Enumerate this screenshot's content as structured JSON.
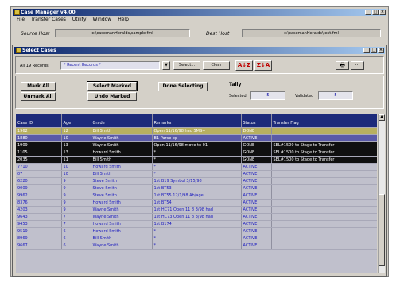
{
  "main_window": {
    "title": "Case Manager v4.00",
    "menu": [
      "File",
      "Transfer Cases",
      "Utility",
      "Window",
      "Help"
    ],
    "source_host_label": "Source Host",
    "source_host_value": "c:\\casemanHeralds\\sample.fml",
    "dest_host_label": "Dest Host",
    "dest_host_value": "c:\\casemanHeralds\\test.fml",
    "buttons": [
      "_",
      "□",
      "×"
    ]
  },
  "select_window": {
    "title": "Select Cases",
    "records_label": "All 19 Records",
    "records_value": "* Recent Records *",
    "select_button": "Select...",
    "clear_button": "Clear",
    "az_button": "A↓Z",
    "za_button": "Z↓A",
    "mark_all": "Mark All",
    "unmark_all": "Unmark All",
    "select_marked": "Select Marked",
    "undo_marked": "Undo Marked",
    "done_selecting": "Done Selecting",
    "tally_label": "Tally",
    "selected_label": "Selected",
    "selected_count": "5",
    "validated_label": "Validated",
    "validated_count": "5",
    "columns": [
      "Case ID",
      "Age",
      "Grade",
      "Remarks",
      "Status",
      "Transfer Flag"
    ],
    "rows": [
      {
        "style": "sel",
        "cells": [
          "1962",
          "12",
          "Bill Smith",
          "Open 11/16/98 had SMS+",
          "DONE",
          ""
        ]
      },
      {
        "style": "olive",
        "cells": [
          "1880",
          "10",
          "Wayne Smith",
          "B1 Parse ep",
          "ACTIVE",
          ""
        ]
      },
      {
        "style": "black",
        "cells": [
          "1909",
          "13",
          "Wayne Smith",
          "Open 11/16/98 move to 01",
          "GONE",
          "SEL#1500 to Stage to Transfer"
        ]
      },
      {
        "style": "black",
        "cells": [
          "1105",
          "13",
          "Howard Smith",
          "*",
          "GONE",
          "SEL#1500 to Stage to Transfer"
        ]
      },
      {
        "style": "black",
        "cells": [
          "2035",
          "11",
          "Bill Smith",
          "*",
          "GONE",
          "SEL#1500 to Stage to Transfer"
        ]
      },
      {
        "style": "white",
        "cells": [
          "7710",
          "10",
          "Howard Smith",
          "*",
          "ACTIVE",
          ""
        ]
      },
      {
        "style": "white",
        "cells": [
          "07",
          "10",
          "Bill Smith",
          "*",
          "ACTIVE",
          ""
        ]
      },
      {
        "style": "white",
        "cells": [
          "6220",
          "9",
          "Steve Smith",
          "1st B19 Symbol 3/15/98",
          "ACTIVE",
          ""
        ]
      },
      {
        "style": "white",
        "cells": [
          "9009",
          "9",
          "Steve Smith",
          "1st BT53",
          "ACTIVE",
          ""
        ]
      },
      {
        "style": "white",
        "cells": [
          "9962",
          "9",
          "Steve Smith",
          "1st BT55 12/1/98 Ab/age",
          "ACTIVE",
          ""
        ]
      },
      {
        "style": "white",
        "cells": [
          "8376",
          "9",
          "Howard Smith",
          "1st BT54",
          "ACTIVE",
          ""
        ]
      },
      {
        "style": "white",
        "cells": [
          "4203",
          "9",
          "Wayne Smith",
          "1st HC71 Open 11 8 3/98 had",
          "ACTIVE",
          ""
        ]
      },
      {
        "style": "white",
        "cells": [
          "9643",
          "7",
          "Wayne Smith",
          "1st HC73 Open 11 8 3/98 had",
          "ACTIVE",
          ""
        ]
      },
      {
        "style": "white",
        "cells": [
          "9453",
          "7",
          "Howard Smith",
          "1st B174",
          "ACTIVE",
          ""
        ]
      },
      {
        "style": "white",
        "cells": [
          "9519",
          "6",
          "Howard Smith",
          "*",
          "ACTIVE",
          ""
        ]
      },
      {
        "style": "white",
        "cells": [
          "8969",
          "6",
          "Bill Smith",
          "*",
          "ACTIVE",
          ""
        ]
      },
      {
        "style": "white",
        "cells": [
          "9667",
          "6",
          "Wayne Smith",
          "*",
          "ACTIVE",
          ""
        ]
      }
    ]
  }
}
